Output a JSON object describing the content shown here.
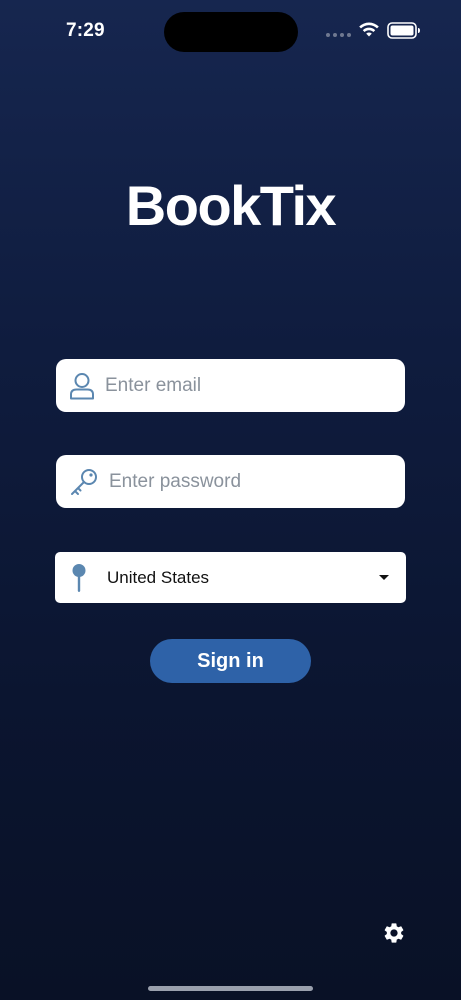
{
  "status_bar": {
    "time": "7:29",
    "icons": [
      "signal-dots-icon",
      "wifi-icon",
      "battery-icon"
    ]
  },
  "app": {
    "logo_text": "BookTix"
  },
  "login_form": {
    "email": {
      "placeholder": "Enter email",
      "value": "",
      "icon": "user-icon"
    },
    "password": {
      "placeholder": "Enter password",
      "value": "",
      "icon": "key-icon"
    },
    "country": {
      "selected": "United States",
      "icon": "location-pin-icon"
    },
    "sign_in_label": "Sign in"
  },
  "footer": {
    "settings_icon": "gear-icon"
  },
  "colors": {
    "background_top": "#16264f",
    "background_bottom": "#091126",
    "accent": "#2e62a8",
    "icon_blue": "#5b87b0",
    "field_bg": "#ffffff"
  }
}
